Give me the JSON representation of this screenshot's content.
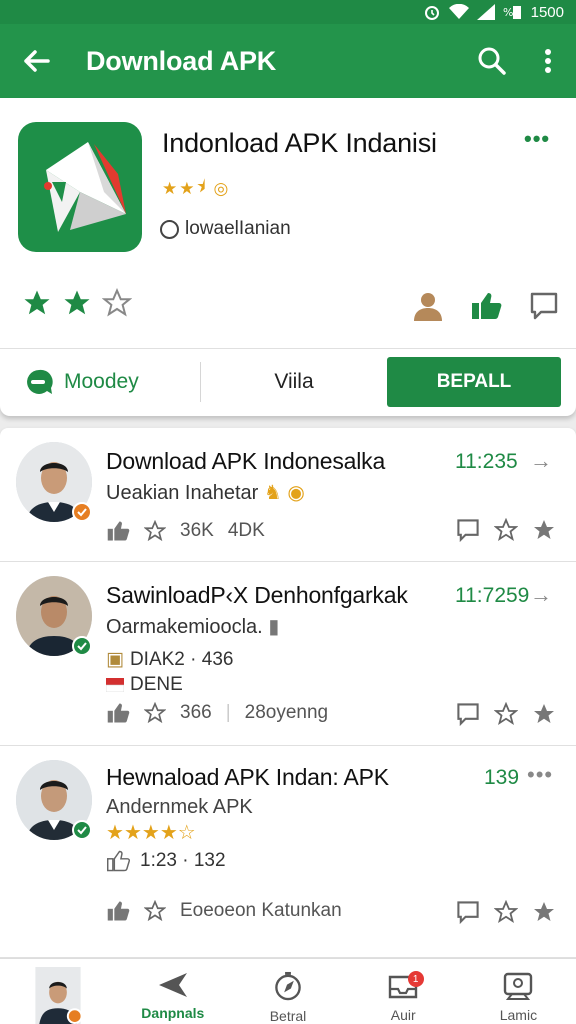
{
  "status_bar": {
    "time": "1500"
  },
  "app_bar": {
    "title": "Download APK"
  },
  "app": {
    "title": "Indonload APK Indanisi",
    "more": "•••",
    "developer": "lowaelIanian",
    "card_rating_stars": 2.5
  },
  "buttons": {
    "modey": "Moodey",
    "viila": "Viila",
    "install": "BEPALL"
  },
  "items": [
    {
      "title": "Download APK Indonesalka",
      "time": "11:235",
      "subtitle": "Ueakian Inahetar",
      "stats": [
        "36K",
        "4DK"
      ]
    },
    {
      "title": "SawinloadP‹X Denhonfgarkak",
      "time": "11:7259",
      "subtitle": "Oarmakemioocla.",
      "line1": "DIAK2 · 436",
      "line2": "DENE",
      "stats": [
        "366",
        "28oyenng"
      ]
    },
    {
      "title": "Hewnaload APK Indan: APK",
      "time": "139",
      "subtitle": "Andernmek APK",
      "rating_stars": 3.5,
      "line1": "1:23 · 132",
      "stats": [
        "Eoeoeon Katunkan"
      ]
    }
  ],
  "bottom_nav": [
    {
      "label": "",
      "icon": "avatar"
    },
    {
      "label": "Danpnals",
      "icon": "send-icon"
    },
    {
      "label": "Betral",
      "icon": "compass-icon"
    },
    {
      "label": "Auir",
      "icon": "inbox-icon",
      "badge": "1"
    },
    {
      "label": "Lamic",
      "icon": "feedback-icon"
    }
  ],
  "colors": {
    "primary": "#23944b",
    "accent_star": "#e3a21a",
    "badge_orange": "#e67e22"
  }
}
